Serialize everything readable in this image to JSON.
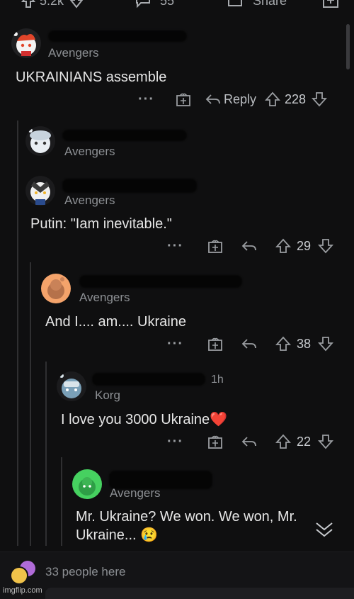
{
  "top_bar": {
    "upvotes": "5.2k",
    "comments": "55",
    "share": "Share"
  },
  "comments": [
    {
      "flair": "Avengers",
      "text": "UKRAINIANS assemble",
      "score": "228",
      "reply_label": "Reply"
    },
    {
      "flair": "Avengers",
      "text": ""
    },
    {
      "flair": "Avengers",
      "text": "Putin: \"Iam inevitable.\"",
      "score": "29"
    },
    {
      "flair": "Avengers",
      "text": "And I.... am.... Ukraine",
      "score": "38"
    },
    {
      "flair": "Korg",
      "text": "I love you 3000 Ukraine",
      "emoji": "❤️",
      "time": "1h",
      "score": "22"
    },
    {
      "flair": "Avengers",
      "text_line1": "Mr. Ukraine? We won. We won, Mr.",
      "text_line2": "Ukraine...",
      "emoji": "😢"
    }
  ],
  "presence": {
    "text": "33 people here"
  },
  "watermark": "imgflip.com",
  "colors": {
    "background": "#0f0f10",
    "text": "#d7dadc",
    "muted": "#8c8f93"
  }
}
